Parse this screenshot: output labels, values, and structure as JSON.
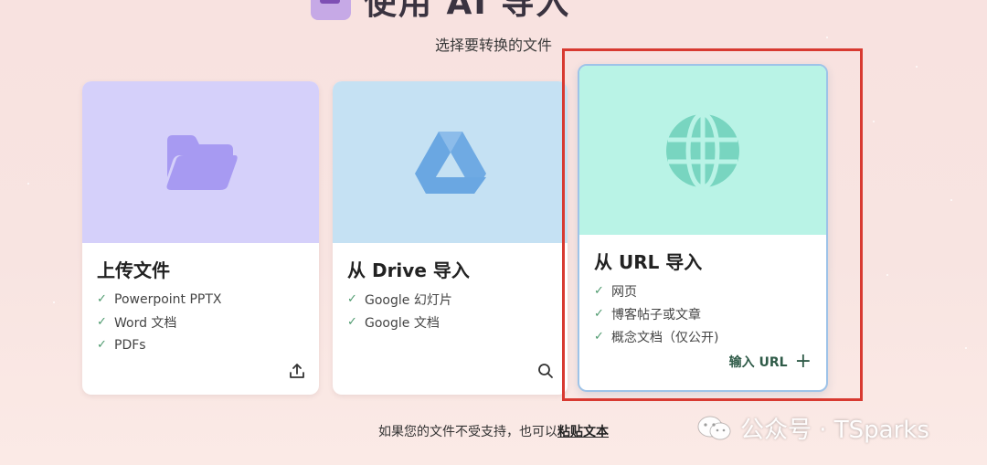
{
  "header": {
    "title": "使用 AI 导入",
    "subtitle": "选择要转换的文件"
  },
  "cards": [
    {
      "title": "上传文件",
      "icon": "folder-icon",
      "color": "#d5d0fa",
      "features": [
        "Powerpoint PPTX",
        "Word 文档",
        "PDFs"
      ],
      "action_icon": "upload-icon"
    },
    {
      "title": "从 Drive 导入",
      "icon": "google-drive-icon",
      "color": "#c5e1f3",
      "features": [
        "Google 幻灯片",
        "Google 文档"
      ],
      "action_icon": "search-icon"
    },
    {
      "title": "从 URL 导入",
      "icon": "globe-icon",
      "color": "#b9f3e6",
      "features": [
        "网页",
        "博客帖子或文章",
        "概念文档（仅公开)"
      ],
      "action_label": "输入 URL",
      "action_icon": "plus-icon"
    }
  ],
  "footer": {
    "text": "如果您的文件不受支持，也可以",
    "link": "粘贴文本"
  },
  "watermark": {
    "text": "公众号 · TSparks"
  },
  "colors": {
    "highlight": "#d83a31",
    "check": "#4e9a6e",
    "folder": "#a79af2",
    "drive": "#6aa7e2",
    "globe": "#78d5c0"
  }
}
